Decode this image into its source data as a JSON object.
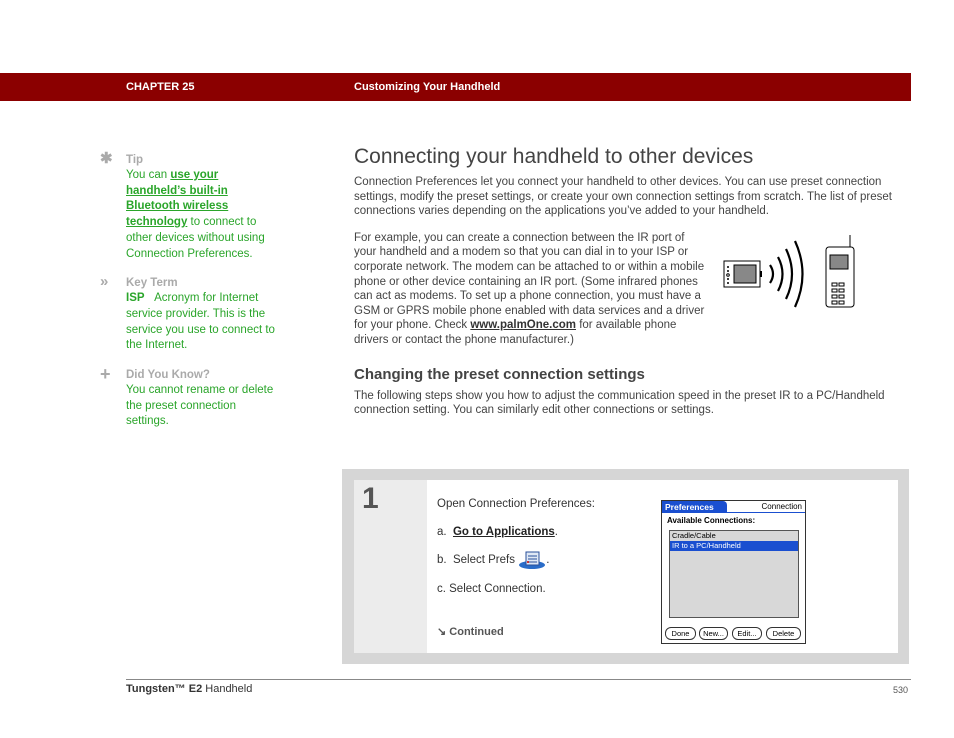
{
  "header": {
    "chapter": "CHAPTER 25",
    "title": "Customizing Your Handheld",
    "color": "#8b0000"
  },
  "sidebar": {
    "tip": {
      "icon": "asterisk-icon",
      "heading": "Tip",
      "prefix": "You can ",
      "link": "use your handheld’s built-in Bluetooth wireless technology",
      "suffix": " to connect to other devices without using Connection Preferences."
    },
    "key_term": {
      "icon": "double-chevron-icon",
      "heading": "Key Term",
      "term": "ISP",
      "definition": "Acronym for Internet service provider. This is the service you use to connect to the Internet."
    },
    "did_you_know": {
      "icon": "plus-icon",
      "heading": "Did You Know?",
      "body": "You cannot rename or delete the preset connection settings."
    },
    "text_color": "#2aa52a"
  },
  "main": {
    "title": "Connecting your handheld to other devices",
    "intro": "Connection Preferences let you connect your handheld to other devices. You can use preset connection settings, modify the preset settings, or create your own connection settings from scratch. The list of preset connections varies depending on the applications you’ve added to your handheld.",
    "example_before": "For example, you can create a connection between the IR port of your handheld and a modem so that you can dial in to your ISP or corporate network. The modem can be attached to or within a mobile phone or other device containing an IR port. (Some infrared phones can act as modems. To set up a phone connection, you must have a GSM or GPRS mobile phone enabled with data services and a driver for your phone. Check ",
    "example_link": "www.palmOne.com",
    "example_after": " for available phone drivers or contact the phone manufacturer.)",
    "illustration": "handheld-ir-to-phone-illustration",
    "subheading": "Changing the preset connection settings",
    "sub_intro": "The following steps show you how to adjust the communication speed in the preset IR to a PC/Handheld connection setting. You can similarly edit other connections or settings."
  },
  "step": {
    "number": "1",
    "intro": "Open Connection Preferences:",
    "a_prefix": "a.  ",
    "a_link": "Go to Applications",
    "a_suffix": ".",
    "b_text": "b.  Select Prefs ",
    "b_suffix": ".",
    "c_text": "c.  Select Connection.",
    "continued": "Continued"
  },
  "palm_screen": {
    "tab": "Preferences",
    "app_title": "Connection",
    "label": "Available Connections:",
    "items": [
      {
        "label": "Cradle/Cable",
        "selected": false
      },
      {
        "label": "IR to a PC/Handheld",
        "selected": true
      }
    ],
    "buttons": [
      "Done",
      "New...",
      "Edit...",
      "Delete"
    ]
  },
  "footer": {
    "product_bold": "Tungsten™ E2",
    "product_rest": " Handheld",
    "page": "530"
  }
}
